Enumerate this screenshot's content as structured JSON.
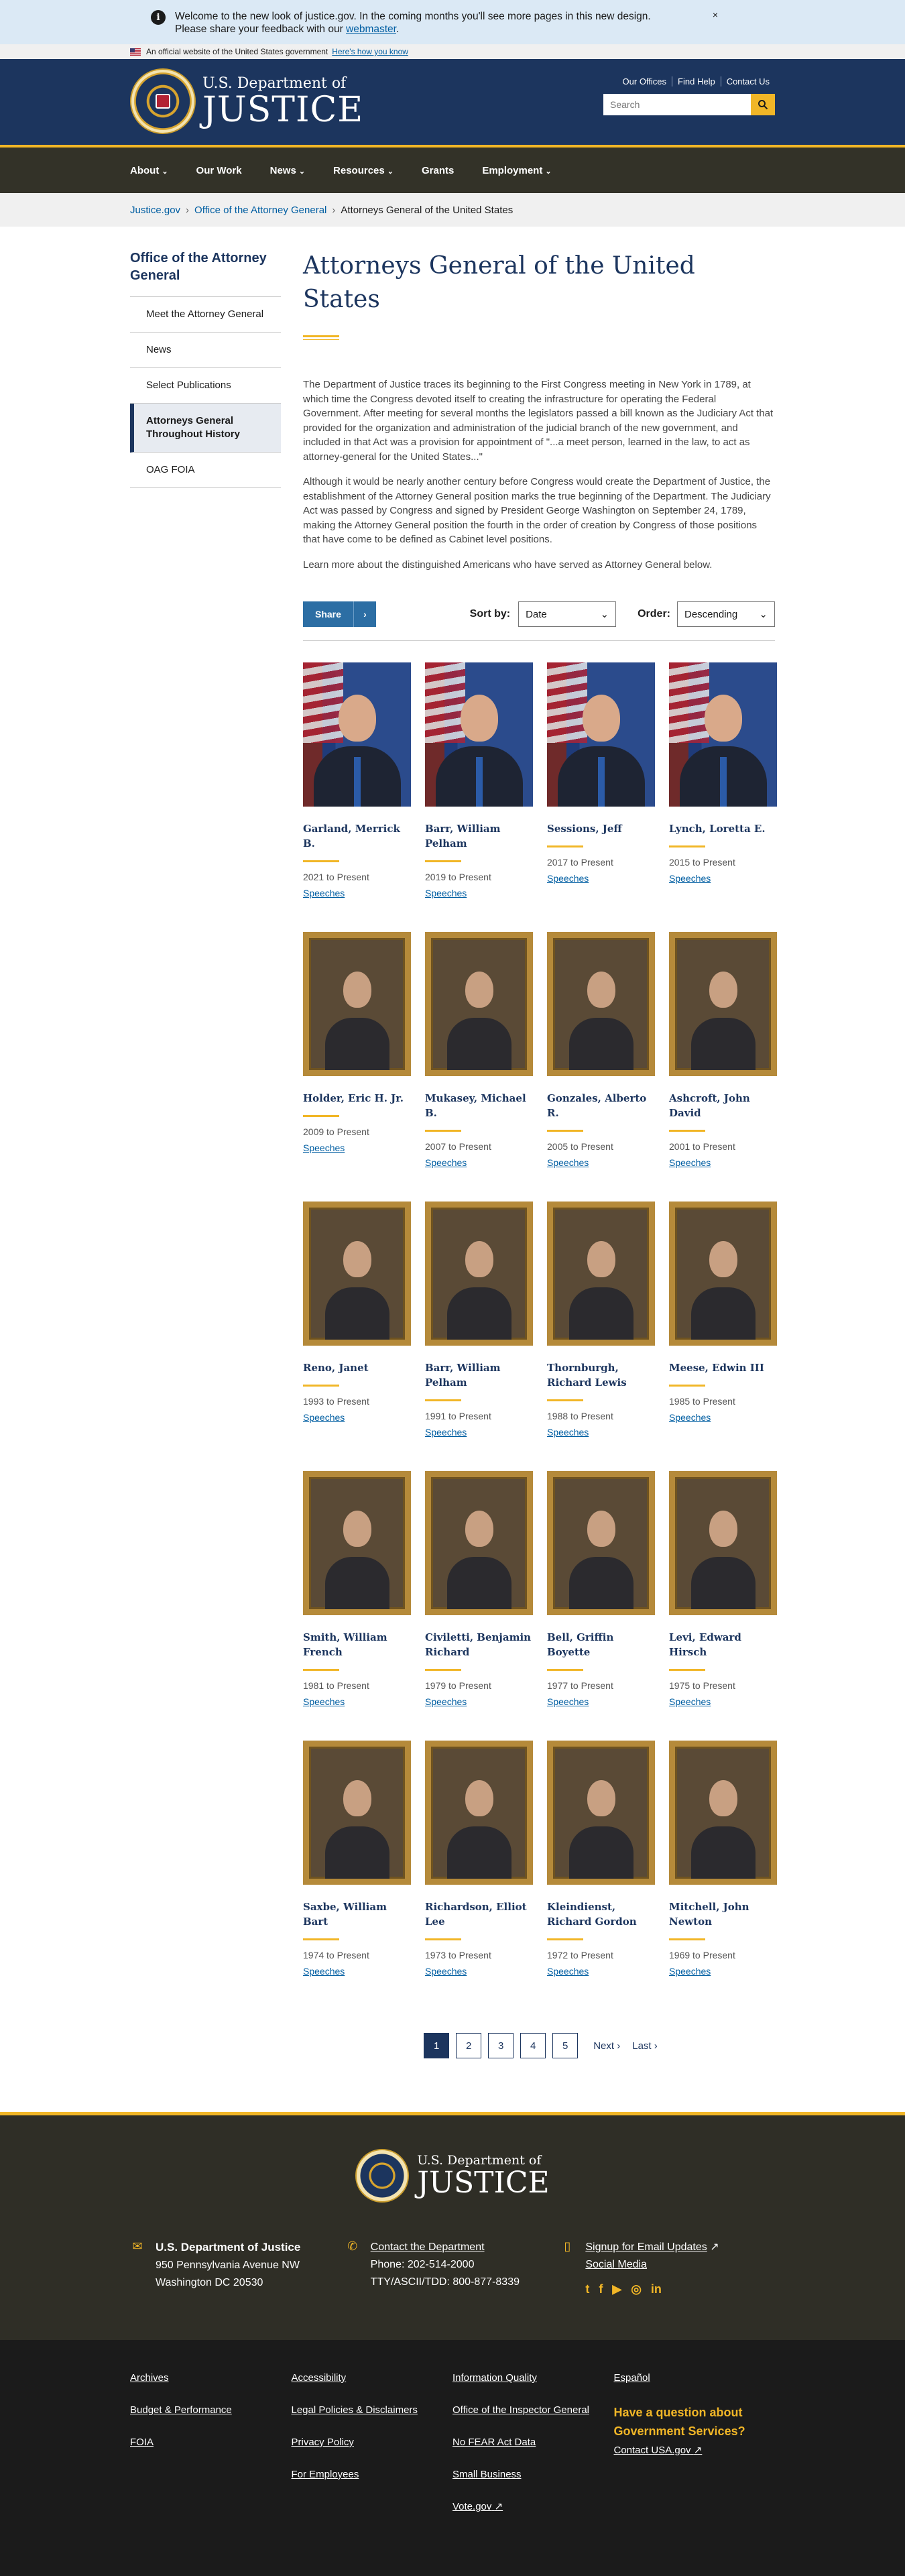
{
  "banner": {
    "message": "Welcome to the new look of justice.gov. In the coming months you'll see more pages in this new design. Please share your feedback with our ",
    "link": "webmaster",
    "end": ".",
    "close": "×"
  },
  "official": {
    "text": "An official website of the United States government",
    "link": "Here's how you know"
  },
  "header": {
    "brand_small": "U.S. Department of",
    "brand_large": "JUSTICE",
    "utility": [
      "Our Offices",
      "Find Help",
      "Contact Us"
    ],
    "search_placeholder": "Search"
  },
  "nav": [
    "About",
    "Our Work",
    "News",
    "Resources",
    "Grants",
    "Employment"
  ],
  "breadcrumb": [
    "Justice.gov",
    "Office of the Attorney General",
    "Attorneys General of the United States"
  ],
  "sidebar": {
    "title": "Office of the Attorney General",
    "items": [
      "Meet the Attorney General",
      "News",
      "Select Publications",
      "Attorneys General Throughout History",
      "OAG FOIA"
    ]
  },
  "main": {
    "title": "Attorneys General of the United States",
    "paragraphs": [
      "The Department of Justice traces its beginning to the First Congress meeting in New York in 1789, at which time the Congress devoted itself to creating the infrastructure for operating the Federal Government. After meeting for several months the legislators passed a bill known as the Judiciary Act that provided for the organization and administration of the judicial branch of the new government, and included in that Act was a provision for appointment of \"...a meet person, learned in the law, to act as attorney-general for the United States...\"",
      "Although it would be nearly another century before Congress would create the Department of Justice, the establishment of the Attorney General position marks the true beginning of the Department. The Judiciary Act was passed by Congress and signed by President George Washington on September 24, 1789, making the Attorney General position the fourth in the order of creation by Congress of those positions that have come to be defined as Cabinet level positions.",
      "Learn more about the distinguished Americans who have served as Attorney General below."
    ],
    "share": "Share",
    "sort_label": "Sort by:",
    "sort_value": "Date",
    "order_label": "Order:",
    "order_value": "Descending",
    "speeches": "Speeches"
  },
  "attorneys": [
    {
      "name": "Garland, Merrick B.",
      "years": "2021 to Present",
      "type": "photo"
    },
    {
      "name": "Barr, William Pelham",
      "years": "2019 to Present",
      "type": "photo"
    },
    {
      "name": "Sessions, Jeff",
      "years": "2017 to Present",
      "type": "photo"
    },
    {
      "name": "Lynch, Loretta E.",
      "years": "2015 to Present",
      "type": "photo"
    },
    {
      "name": "Holder, Eric H. Jr.",
      "years": "2009 to Present",
      "type": "portrait"
    },
    {
      "name": "Mukasey, Michael B.",
      "years": "2007 to Present",
      "type": "portrait"
    },
    {
      "name": "Gonzales, Alberto R.",
      "years": "2005 to Present",
      "type": "portrait"
    },
    {
      "name": "Ashcroft, John David",
      "years": "2001 to Present",
      "type": "portrait"
    },
    {
      "name": "Reno, Janet",
      "years": "1993 to Present",
      "type": "portrait"
    },
    {
      "name": "Barr, William Pelham",
      "years": "1991 to Present",
      "type": "portrait"
    },
    {
      "name": "Thornburgh, Richard Lewis",
      "years": "1988 to Present",
      "type": "portrait"
    },
    {
      "name": "Meese, Edwin III",
      "years": "1985 to Present",
      "type": "portrait"
    },
    {
      "name": "Smith, William French",
      "years": "1981 to Present",
      "type": "portrait"
    },
    {
      "name": "Civiletti, Benjamin Richard",
      "years": "1979 to Present",
      "type": "portrait"
    },
    {
      "name": "Bell, Griffin Boyette",
      "years": "1977 to Present",
      "type": "portrait"
    },
    {
      "name": "Levi, Edward Hirsch",
      "years": "1975 to Present",
      "type": "portrait"
    },
    {
      "name": "Saxbe, William Bart",
      "years": "1974 to Present",
      "type": "portrait"
    },
    {
      "name": "Richardson, Elliot Lee",
      "years": "1973 to Present",
      "type": "portrait"
    },
    {
      "name": "Kleindienst, Richard Gordon",
      "years": "1972 to Present",
      "type": "portrait"
    },
    {
      "name": "Mitchell, John Newton",
      "years": "1969 to Present",
      "type": "portrait"
    }
  ],
  "pager": {
    "pages": [
      "1",
      "2",
      "3",
      "4",
      "5"
    ],
    "current": "1",
    "next": "Next",
    "last": "Last"
  },
  "footer": {
    "brand_small": "U.S. Department of",
    "brand_large": "JUSTICE",
    "address_title": "U.S. Department of Justice",
    "address_1": "950 Pennsylvania Avenue NW",
    "address_2": "Washington DC 20530",
    "contact_title": "Contact the Department",
    "phone": "Phone: 202-514-2000",
    "tty": "TTY/ASCII/TDD: 800-877-8339",
    "signup": "Signup for Email Updates",
    "social": "Social Media"
  },
  "subfooter": {
    "col1": [
      "Archives",
      "Budget & Performance",
      "FOIA"
    ],
    "col2": [
      "Accessibility",
      "Legal Policies & Disclaimers",
      "Privacy Policy",
      "For Employees"
    ],
    "col3": [
      "Information Quality",
      "Office of the Inspector General",
      "No FEAR Act Data",
      "Small Business",
      "Vote.gov"
    ],
    "col4_link": "Español",
    "help": "Have a question about Government Services?",
    "usa": "Contact USA.gov"
  },
  "colors": {
    "navy": "#1c355e",
    "gold": "#f1b627",
    "link": "#005ea2"
  }
}
